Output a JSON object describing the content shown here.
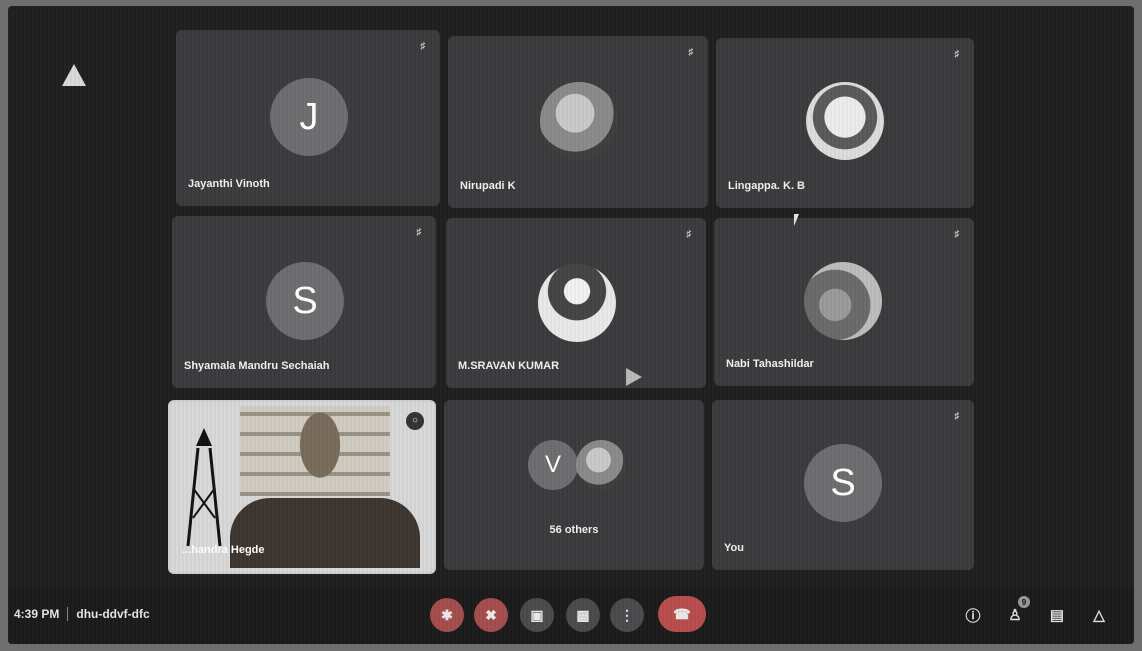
{
  "participants": [
    {
      "name": "Jayanthi Vinoth",
      "avatar_letter": "J"
    },
    {
      "name": "Nirupadi K",
      "avatar_letter": ""
    },
    {
      "name": "Lingappa. K. B",
      "avatar_letter": ""
    },
    {
      "name": "Shyamala Mandru Sechaiah",
      "avatar_letter": "S"
    },
    {
      "name": "M.SRAVAN KUMAR",
      "avatar_letter": ""
    },
    {
      "name": "Nabi Tahashildar",
      "avatar_letter": ""
    },
    {
      "name": "...handra Hegde",
      "avatar_letter": ""
    },
    {
      "name": "56 others",
      "avatar_letter": "V"
    },
    {
      "name": "You",
      "avatar_letter": "S"
    }
  ],
  "meeting": {
    "time": "4:39 PM",
    "code": "dhu-ddvf-dfc"
  },
  "controls": {
    "mic_icon": "mic-off-icon",
    "camera_icon": "camera-off-icon",
    "captions_icon": "captions-icon",
    "present_icon": "present-icon",
    "more_icon": "more-options-icon",
    "end_icon": "end-call-icon"
  },
  "side": {
    "info_icon": "meeting-info-icon",
    "people_icon": "people-icon",
    "people_badge": "9",
    "chat_icon": "chat-icon",
    "activities_icon": "activities-icon"
  },
  "colors": {
    "background": "#1f1f20",
    "tile": "#3b3b3d",
    "end_call": "#b84e4e"
  }
}
